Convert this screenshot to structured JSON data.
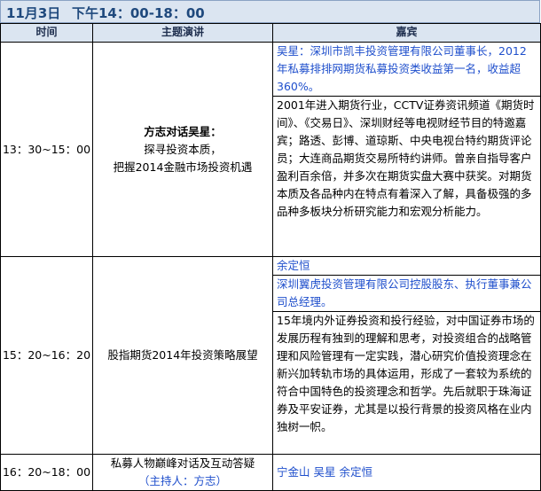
{
  "header": {
    "date": "11月3日",
    "session": "下午14：00-18：00"
  },
  "columns": {
    "time": "时间",
    "topic": "主题演讲",
    "guest": "嘉宾"
  },
  "rows": [
    {
      "time": "13：30~15：00",
      "topic_title": "方志对话吴星：",
      "topic_line2": "探寻投资本质，",
      "topic_line3": "把握2014金融市场投资机遇",
      "guest_title": "吴星：深圳市凯丰投资管理有限公司董事长，2012年私募排排网期货私募投资类收益第一名，收益超360%。",
      "guest_bio": "2001年进入期货行业，CCTV证券资讯频道《期货时间》、《交易日》、深圳财经等电视财经节目的特邀嘉宾；路透、彭博、道琼斯、中央电视台特约期货评论员；大连商品期货交易所特约讲师。曾亲自指导客户盈利百余倍，并多次在期货实盘大赛中获奖。对期货本质及各品种内在特点有着深入了解，具备极强的多品种多板块分析研究能力和宏观分析能力。"
    },
    {
      "time": "15：20~16：20",
      "topic_title": "股指期货2014年投资策略展望",
      "guest_name": "余定恒",
      "guest_title": "深圳翼虎投资管理有限公司控股股东、执行董事兼公司总经理。",
      "guest_bio": "15年境内外证券投资和投行经验，对中国证券市场的发展历程有独到的理解和思考，对投资组合的战略管理和风险管理有一定实践，潜心研究价值投资理念在新兴加转轨市场的具体运用，形成了一套较为系统的符合中国特色的投资理念和哲学。先后就职于珠海证券及平安证券，尤其是以投行背景的投资风格在业内独树一帜。"
    },
    {
      "time": "16：20~18：00",
      "topic_title": "私募人物巅峰对话及互动答疑",
      "topic_line2": "（主持人：方志）",
      "guest_names": "宁金山  吴星  余定恒"
    }
  ]
}
